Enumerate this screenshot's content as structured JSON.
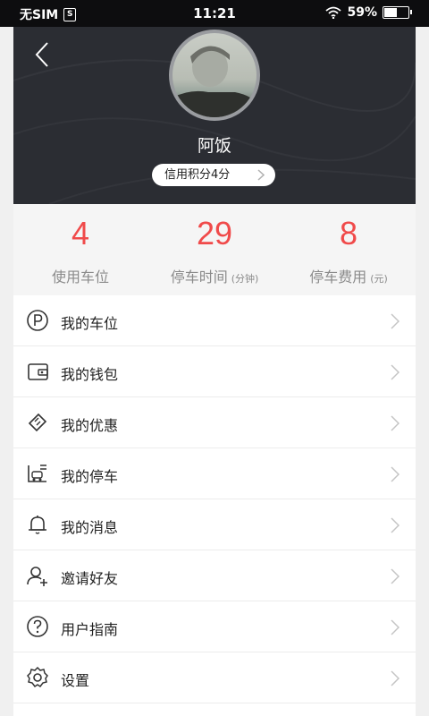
{
  "status_bar": {
    "carrier": "无SIM",
    "sim_icon": "S",
    "time": "11:21",
    "battery_percent": "59%",
    "battery_level": 0.59
  },
  "header": {
    "username": "阿饭",
    "credit_label": "信用积分4分"
  },
  "stats": [
    {
      "value": "4",
      "label": "使用车位",
      "unit": ""
    },
    {
      "value": "29",
      "label": "停车时间",
      "unit": "(分钟)"
    },
    {
      "value": "8",
      "label": "停车费用",
      "unit": "(元)"
    }
  ],
  "menu": [
    {
      "label": "我的车位",
      "icon": "parking-icon"
    },
    {
      "label": "我的钱包",
      "icon": "wallet-icon"
    },
    {
      "label": "我的优惠",
      "icon": "coupon-icon"
    },
    {
      "label": "我的停车",
      "icon": "parking-record-icon"
    },
    {
      "label": "我的消息",
      "icon": "bell-icon"
    },
    {
      "label": "邀请好友",
      "icon": "invite-user-icon"
    },
    {
      "label": "用户指南",
      "icon": "help-icon"
    },
    {
      "label": "设置",
      "icon": "gear-icon"
    }
  ],
  "colors": {
    "accent": "#f04a4a",
    "header_bg": "#2b2d33",
    "stats_bg": "#f5f5f5"
  }
}
